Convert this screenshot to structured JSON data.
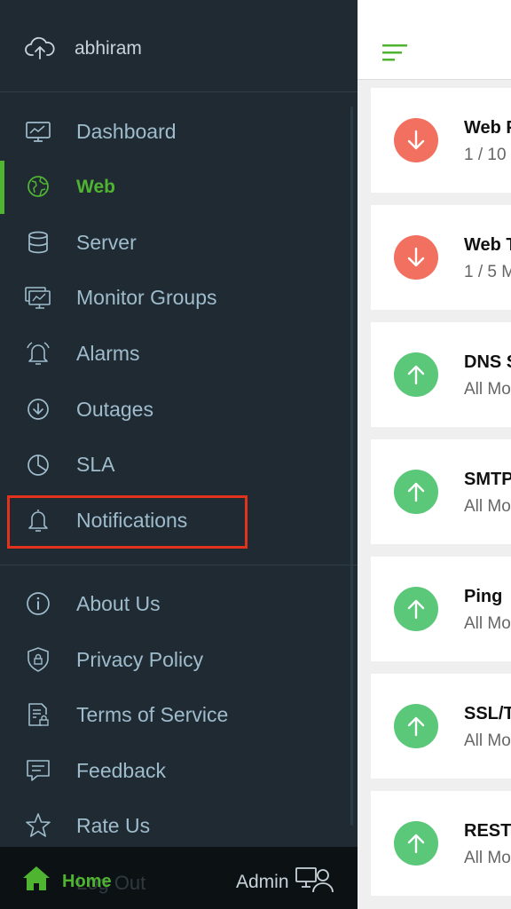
{
  "profile": {
    "name": "abhiram",
    "icon": "cloud-upload-icon"
  },
  "nav_primary": [
    {
      "label": "Dashboard",
      "icon": "dashboard-icon"
    },
    {
      "label": "Web",
      "icon": "globe-icon",
      "active": true
    },
    {
      "label": "Server",
      "icon": "database-icon"
    },
    {
      "label": "Monitor Groups",
      "icon": "monitor-group-icon"
    },
    {
      "label": "Alarms",
      "icon": "alarm-bell-icon"
    },
    {
      "label": "Outages",
      "icon": "down-circle-icon"
    },
    {
      "label": "SLA",
      "icon": "pie-chart-icon"
    },
    {
      "label": "Notifications",
      "icon": "bell-icon"
    }
  ],
  "nav_secondary": [
    {
      "label": "About Us",
      "icon": "info-icon"
    },
    {
      "label": "Privacy Policy",
      "icon": "shield-lock-icon"
    },
    {
      "label": "Terms of Service",
      "icon": "document-lock-icon"
    },
    {
      "label": "Feedback",
      "icon": "feedback-icon"
    },
    {
      "label": "Rate Us",
      "icon": "star-icon"
    }
  ],
  "bottom_bar": {
    "home_label": "Home",
    "logout_label": "Log Out",
    "admin_label": "Admin"
  },
  "monitors": [
    {
      "title": "Web P",
      "subtitle": "1 / 10",
      "status": "down"
    },
    {
      "title": "Web T",
      "subtitle": "1 / 5 M",
      "status": "down"
    },
    {
      "title": "DNS S",
      "subtitle": "All Mo",
      "status": "up"
    },
    {
      "title": "SMTP",
      "subtitle": "All Mo",
      "status": "up"
    },
    {
      "title": "Ping",
      "subtitle": "All Mo",
      "status": "up"
    },
    {
      "title": "SSL/T",
      "subtitle": "All Mo",
      "status": "up"
    },
    {
      "title": "REST",
      "subtitle": "All Mo",
      "status": "up"
    }
  ],
  "colors": {
    "drawer_bg": "#1f2a33",
    "accent": "#4fb531",
    "down": "#f1705f",
    "up": "#5ac878",
    "highlight": "#e0321c"
  }
}
